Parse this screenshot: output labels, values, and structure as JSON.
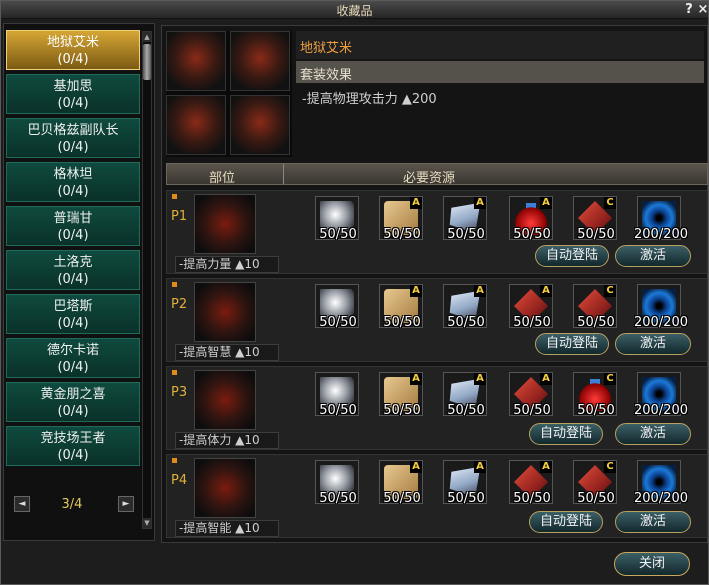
{
  "window": {
    "title": "收藏品",
    "help_icon": "?",
    "close_icon": "×"
  },
  "sidebar": {
    "items": [
      {
        "name": "地狱艾米",
        "progress": "(0/4)"
      },
      {
        "name": "基加思",
        "progress": "(0/4)"
      },
      {
        "name": "巴贝格兹副队长",
        "progress": "(0/4)"
      },
      {
        "name": "格林坦",
        "progress": "(0/4)"
      },
      {
        "name": "普瑞甘",
        "progress": "(0/4)"
      },
      {
        "name": "土洛克",
        "progress": "(0/4)"
      },
      {
        "name": "巴塔斯",
        "progress": "(0/4)"
      },
      {
        "name": "德尔卡诺",
        "progress": "(0/4)"
      },
      {
        "name": "黄金朋之喜",
        "progress": "(0/4)"
      },
      {
        "name": "竞技场王者",
        "progress": "(0/4)"
      }
    ],
    "page": "3/4",
    "prev_icon": "◄",
    "next_icon": "►",
    "scroll_up": "▲",
    "scroll_down": "▼"
  },
  "detail": {
    "set_name": "地狱艾米",
    "set_effect_label": "套装效果",
    "set_effect_value": "-提高物理攻击力 ▲200",
    "header_part": "部位",
    "header_resources": "必要资源"
  },
  "rows": [
    {
      "label": "P1",
      "stat": "-提高力量 ▲10",
      "materials": [
        {
          "icon": "silver-ore-icon",
          "grade": "",
          "count": "50/50"
        },
        {
          "icon": "leather-icon",
          "grade": "A",
          "count": "50/50"
        },
        {
          "icon": "cloth-icon",
          "grade": "A",
          "count": "50/50"
        },
        {
          "icon": "potion-icon",
          "grade": "A",
          "count": "50/50"
        },
        {
          "icon": "red-gem-icon",
          "grade": "C",
          "count": "50/50"
        },
        {
          "icon": "vortex-icon",
          "grade": "",
          "count": "200/200"
        }
      ],
      "auto_btn": "自动登陆",
      "activate_btn": "激活"
    },
    {
      "label": "P2",
      "stat": "-提高智慧 ▲10",
      "materials": [
        {
          "icon": "silver-ore-icon",
          "grade": "",
          "count": "50/50"
        },
        {
          "icon": "leather-icon",
          "grade": "A",
          "count": "50/50"
        },
        {
          "icon": "cloth-icon",
          "grade": "A",
          "count": "50/50"
        },
        {
          "icon": "red-gem-icon",
          "grade": "A",
          "count": "50/50"
        },
        {
          "icon": "red-gem-icon",
          "grade": "C",
          "count": "50/50"
        },
        {
          "icon": "vortex-icon",
          "grade": "",
          "count": "200/200"
        }
      ],
      "auto_btn": "自动登陆",
      "activate_btn": "激活"
    },
    {
      "label": "P3",
      "stat": "-提高体力 ▲10",
      "materials": [
        {
          "icon": "silver-ore-icon",
          "grade": "",
          "count": "50/50"
        },
        {
          "icon": "leather-icon",
          "grade": "A",
          "count": "50/50"
        },
        {
          "icon": "cloth-icon",
          "grade": "A",
          "count": "50/50"
        },
        {
          "icon": "red-gem-icon",
          "grade": "A",
          "count": "50/50"
        },
        {
          "icon": "potion-icon",
          "grade": "C",
          "count": "50/50"
        },
        {
          "icon": "vortex-icon",
          "grade": "",
          "count": "200/200"
        }
      ],
      "auto_btn": "自动登陆",
      "activate_btn": "激活"
    },
    {
      "label": "P4",
      "stat": "-提高智能 ▲10",
      "materials": [
        {
          "icon": "silver-ore-icon",
          "grade": "",
          "count": "50/50"
        },
        {
          "icon": "leather-icon",
          "grade": "A",
          "count": "50/50"
        },
        {
          "icon": "cloth-icon",
          "grade": "A",
          "count": "50/50"
        },
        {
          "icon": "red-gem-icon",
          "grade": "A",
          "count": "50/50"
        },
        {
          "icon": "red-gem-icon",
          "grade": "C",
          "count": "50/50"
        },
        {
          "icon": "vortex-icon",
          "grade": "",
          "count": "200/200"
        }
      ],
      "auto_btn": "自动登陆",
      "activate_btn": "激活"
    }
  ],
  "footer": {
    "close_btn": "关闭"
  }
}
